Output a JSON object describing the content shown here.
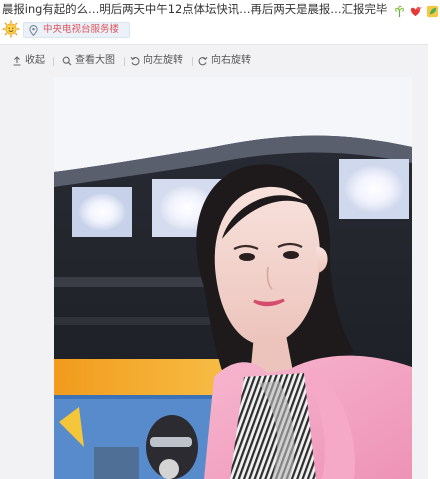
{
  "post": {
    "text": "晨报ing有起的么…明后两天中午12点体坛快讯…再后两天是晨报…汇报完毕",
    "emojis": [
      "clover-emoji",
      "hearts-emoji",
      "leaf-emoji"
    ]
  },
  "location": {
    "icon": "sun-emoji",
    "tag_icon": "map-pin-icon",
    "label": "中央电视台服务楼"
  },
  "toolbar": {
    "collapse_label": "收起",
    "view_large_label": "查看大图",
    "rotate_left_label": "向左旋转",
    "rotate_right_label": "向右旋转"
  },
  "colors": {
    "tag_text": "#e0585e",
    "tag_bg": "#eaf1f8",
    "media_bg": "#f2f2f5"
  }
}
